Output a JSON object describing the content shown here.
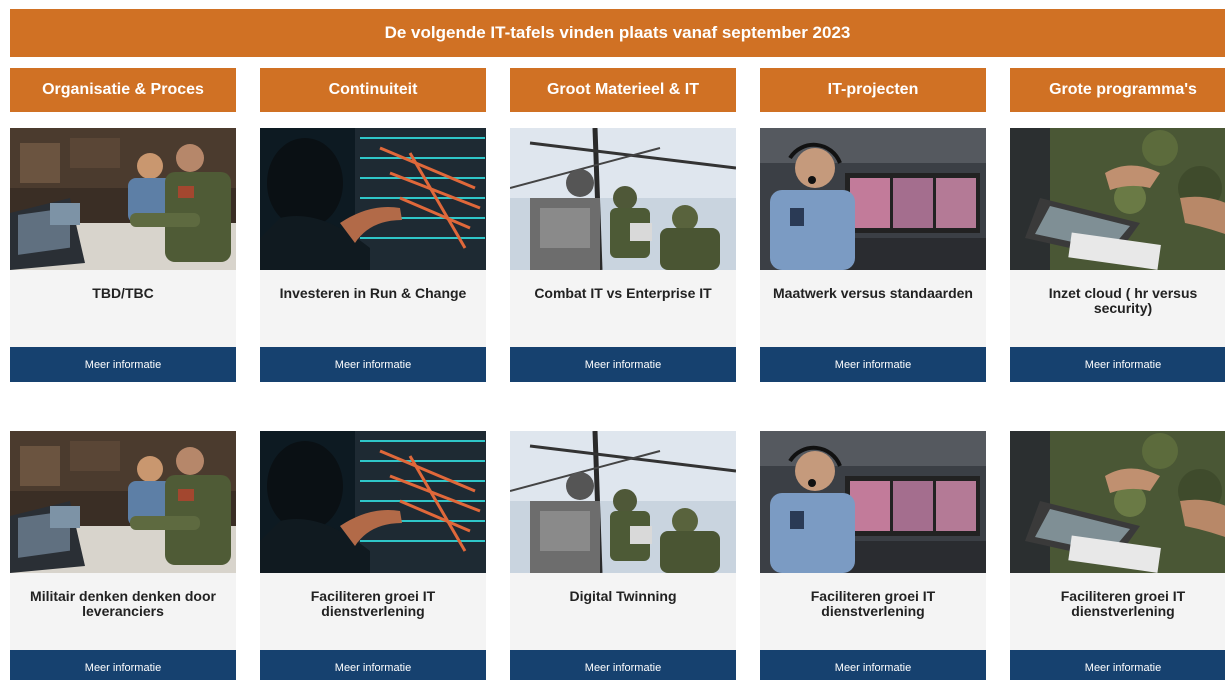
{
  "banner": {
    "title": "De volgende IT-tafels vinden plaats vanaf september 2023"
  },
  "columns": [
    {
      "header": "Organisatie & Proces",
      "image": "server-room-technicians-photo"
    },
    {
      "header": "Continuiteit",
      "image": "datacenter-cabling-photo"
    },
    {
      "header": "Groot Materieel & IT",
      "image": "soldiers-antenna-mast-photo"
    },
    {
      "header": "IT-projecten",
      "image": "operator-headset-console-photo"
    },
    {
      "header": "Grote programma's",
      "image": "soldier-rugged-laptop-photo"
    }
  ],
  "rows": [
    {
      "cards": [
        {
          "title": "TBD/TBC",
          "button": "Meer informatie"
        },
        {
          "title": "Investeren in Run & Change",
          "button": "Meer informatie"
        },
        {
          "title": "Combat IT vs Enterprise IT",
          "button": "Meer informatie"
        },
        {
          "title": "Maatwerk versus standaarden",
          "button": "Meer informatie"
        },
        {
          "title": "Inzet cloud ( hr versus security)",
          "button": "Meer informatie"
        }
      ]
    },
    {
      "cards": [
        {
          "title": "Militair denken denken door leveranciers",
          "button": "Meer informatie"
        },
        {
          "title": "Faciliteren groei IT dienstverlening",
          "button": "Meer informatie"
        },
        {
          "title": "Digital Twinning",
          "button": "Meer informatie"
        },
        {
          "title": "Faciliteren groei IT dienstverlening",
          "button": "Meer informatie"
        },
        {
          "title": "Faciliteren groei IT dienstverlening",
          "button": "Meer informatie"
        }
      ]
    }
  ],
  "colors": {
    "accent": "#d07124",
    "button": "#16416f",
    "card": "#f4f4f4"
  }
}
